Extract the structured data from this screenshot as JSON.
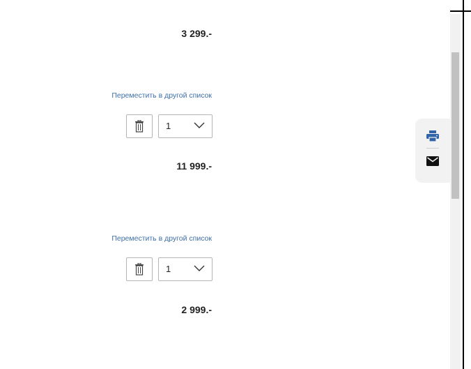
{
  "items": [
    {
      "price": "3 299.-"
    },
    {
      "move_link": "Переместить в другой список",
      "quantity": "1",
      "price": "11 999.-"
    },
    {
      "move_link": "Переместить в другой список",
      "quantity": "1",
      "price": "2 999.-"
    }
  ],
  "side_tools": {
    "print_icon": "printer-icon",
    "mail_icon": "envelope-icon"
  },
  "colors": {
    "link": "#3d6ea8",
    "print_icon": "#2f64a8",
    "price": "#222222"
  }
}
